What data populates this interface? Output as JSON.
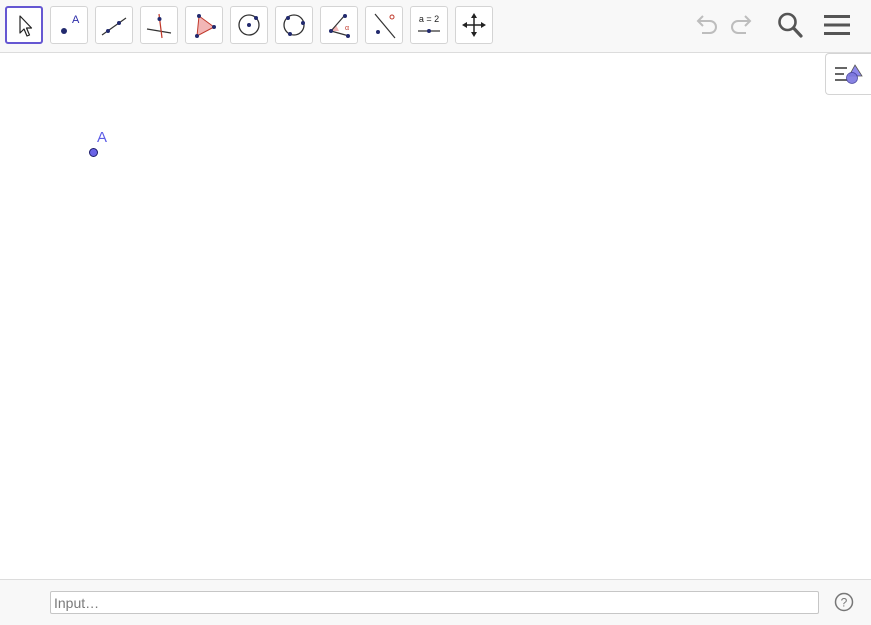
{
  "toolbar": {
    "tools": [
      {
        "name": "move-tool",
        "selected": true
      },
      {
        "name": "point-tool",
        "label": "A"
      },
      {
        "name": "line-tool"
      },
      {
        "name": "perpendicular-line-tool"
      },
      {
        "name": "polygon-tool"
      },
      {
        "name": "circle-center-point-tool"
      },
      {
        "name": "circle-three-points-tool"
      },
      {
        "name": "angle-tool"
      },
      {
        "name": "reflect-about-line-tool"
      },
      {
        "name": "slider-tool",
        "label": "a = 2"
      },
      {
        "name": "move-graphics-view-tool"
      }
    ],
    "undo_icon": "undo-icon",
    "redo_icon": "redo-icon",
    "search_icon": "search-icon",
    "menu_icon": "hamburger-menu-icon"
  },
  "canvas": {
    "points": [
      {
        "label": "A",
        "color": "#6a63e6"
      }
    ]
  },
  "style_bar": {
    "icon": "style-bar-toggle-icon"
  },
  "input_bar": {
    "placeholder": "Input…",
    "value": "",
    "help_icon": "help-icon"
  },
  "colors": {
    "accent": "#6557d2",
    "point": "#6a63e6",
    "label": "#5c5ce6"
  }
}
